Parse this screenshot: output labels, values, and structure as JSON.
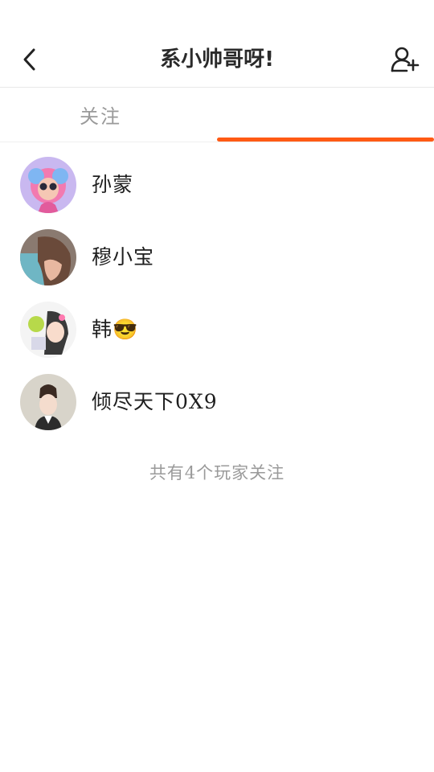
{
  "header": {
    "title": "系小帅哥呀!",
    "back_icon": "chevron-left-icon",
    "add_icon": "add-user-icon"
  },
  "tabs": [
    {
      "label": "关注",
      "active": false
    },
    {
      "label": "",
      "active": true
    }
  ],
  "colors": {
    "accent": "#ff5a14",
    "muted_text": "#9a9a9a"
  },
  "users": [
    {
      "name": "孙蒙"
    },
    {
      "name": "穆小宝"
    },
    {
      "name": "韩😎"
    },
    {
      "name": "倾尽天下0X9"
    }
  ],
  "footer": {
    "summary": "共有4个玩家关注"
  }
}
